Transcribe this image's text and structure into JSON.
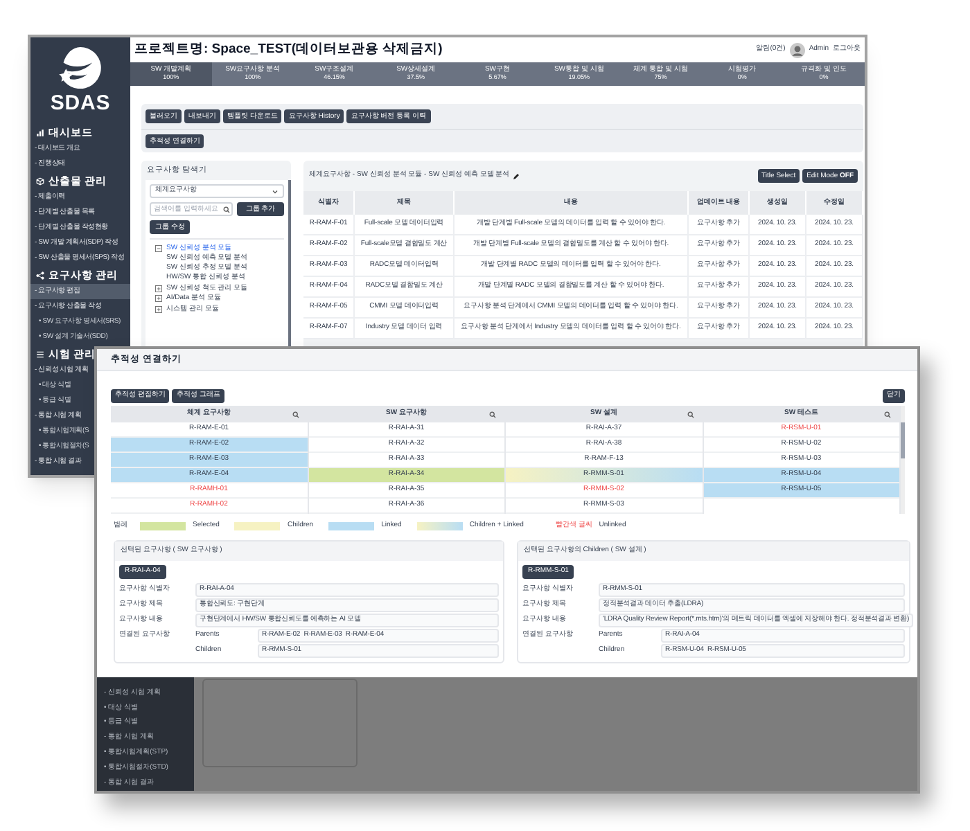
{
  "back_window": {
    "logo": "SDAS",
    "sidebar": [
      {
        "kind": "section",
        "label": "대시보드",
        "selected": false
      },
      {
        "kind": "item",
        "label": "- 대시보드 개요",
        "selected": false
      },
      {
        "kind": "item",
        "label": "- 진행상태",
        "selected": false
      },
      {
        "kind": "section",
        "label": "산출물 관리",
        "selected": false
      },
      {
        "kind": "item",
        "label": "- 제출이력",
        "selected": false
      },
      {
        "kind": "item",
        "label": "- 단계별 산출물 목록",
        "selected": false
      },
      {
        "kind": "item",
        "label": "- 단계별 산출물 작성현황",
        "selected": false
      },
      {
        "kind": "item",
        "label": "- SW 개발 계획서(SDP) 작성",
        "selected": false
      },
      {
        "kind": "item",
        "label": "- SW 산출물 명세서(SPS) 작성",
        "selected": false
      },
      {
        "kind": "section",
        "label": "요구사항 관리",
        "selected": false
      },
      {
        "kind": "item",
        "label": "- 요구사항 편집",
        "selected": true
      },
      {
        "kind": "item",
        "label": "- 요구사항 산출물 작성",
        "selected": false
      },
      {
        "kind": "subitem",
        "label": "• SW 요구사항 명세서(SRS)",
        "selected": false
      },
      {
        "kind": "subitem",
        "label": "• SW 설계 기술서(SDD)",
        "selected": false
      },
      {
        "kind": "section",
        "label": "시험 관리",
        "selected": false
      },
      {
        "kind": "item",
        "label": "- 신뢰성 시험 계획",
        "selected": false
      },
      {
        "kind": "subitem",
        "label": "• 대상 식별",
        "selected": false
      },
      {
        "kind": "subitem",
        "label": "• 등급 식별",
        "selected": false
      },
      {
        "kind": "item",
        "label": "- 통합 시험 계획",
        "selected": false
      },
      {
        "kind": "subitem",
        "label": "• 통합시험계획(S",
        "selected": false
      },
      {
        "kind": "subitem",
        "label": "• 통합시험절차(S",
        "selected": false
      },
      {
        "kind": "item",
        "label": "- 통합 시험 결과",
        "selected": false
      }
    ],
    "project_title": "프로젝트명: Space_TEST(데이터보관용 삭제금지)",
    "user": {
      "notice": "알림(0건)",
      "name": "Admin",
      "logout": "로그아웃"
    },
    "progress_steps": [
      {
        "label": "SW 개발계획",
        "value": "100%",
        "selected": true
      },
      {
        "label": "SW요구사항 분석",
        "value": "100%",
        "selected": false
      },
      {
        "label": "SW구조설계",
        "value": "46.15%",
        "selected": false
      },
      {
        "label": "SW상세설계",
        "value": "37.5%",
        "selected": false
      },
      {
        "label": "SW구현",
        "value": "5.67%",
        "selected": false
      },
      {
        "label": "SW통합 및 시험",
        "value": "19.05%",
        "selected": false
      },
      {
        "label": "체계 통합 및 시험",
        "value": "75%",
        "selected": false
      },
      {
        "label": "시험평가",
        "value": "0%",
        "selected": false
      },
      {
        "label": "규격화 및 인도",
        "value": "0%",
        "selected": false
      }
    ],
    "toolbar": [
      "불러오기",
      "내보내기",
      "템플릿 다운로드",
      "요구사항 History",
      "요구사항 버전 등록 이력"
    ],
    "trace_button": "추적성 연결하기",
    "explorer": {
      "title": "요구사항 탐색기",
      "dropdown": "체계요구사항",
      "search_placeholder": "검색어를 입력하세요",
      "add_group": "그룹 추가",
      "edit_group": "그룹 수정",
      "tree": [
        {
          "label": "SW 신뢰성 분석 모듈",
          "expanded": true,
          "selected": true,
          "children": [
            {
              "label": "SW 신뢰성 예측 모델 분석",
              "selected": false
            },
            {
              "label": "SW 신뢰성 추정 모델 분석",
              "selected": false
            },
            {
              "label": "HW/SW 통합 신뢰성 분석",
              "selected": false
            }
          ]
        },
        {
          "label": "SW 신뢰성 척도 관리 모듈",
          "expanded": false,
          "selected": false
        },
        {
          "label": "AI/Data 분석 모듈",
          "expanded": false,
          "selected": false
        },
        {
          "label": "시스템 관리 모듈",
          "expanded": false,
          "selected": false
        }
      ]
    },
    "requirements": {
      "breadcrumb": "체계요구사항 - SW 신뢰성 분석 모듈 - SW 신뢰성 예측 모델 분석",
      "title_select": "Title Select",
      "edit_mode": "Edit Mode **OFF**",
      "columns": [
        "식별자",
        "제목",
        "내용",
        "업데이트 내용",
        "생성일",
        "수정일"
      ],
      "rows": [
        [
          "R-RAM-F-01",
          "Full-scale 모델 데이터입력",
          "개발 단계별 Full-scale 모델의 데이터를 입력 할 수 있어야 한다.",
          "요구사항 추가",
          "2024. 10. 23.",
          "2024. 10. 23."
        ],
        [
          "R-RAM-F-02",
          "Full-scale모델 결함밀도 계산",
          "개발 단계별 Full-scale 모델의 결함밀도를 계산 할 수 있어야 한다.",
          "요구사항 추가",
          "2024. 10. 23.",
          "2024. 10. 23."
        ],
        [
          "R-RAM-F-03",
          "RADC모델 데이터입력",
          "개발 단계별 RADC 모델의 데이터를 입력 할 수 있어야 한다.",
          "요구사항 추가",
          "2024. 10. 23.",
          "2024. 10. 23."
        ],
        [
          "R-RAM-F-04",
          "RADC모델 결함밀도 계산",
          "개발 단계별 RADC 모델의 결함밀도를 계산 할 수 있어야 한다.",
          "요구사항 추가",
          "2024. 10. 23.",
          "2024. 10. 23."
        ],
        [
          "R-RAM-F-05",
          "CMMI 모델 데이터입력",
          "요구사항 분석 단계에서 CMMI 모델의 데이터를 입력 할 수 있어야 한다.",
          "요구사항 추가",
          "2024. 10. 23.",
          "2024. 10. 23."
        ],
        [
          "R-RAM-F-07",
          "Industry 모델 데이터 입력",
          "요구사항 분석 단계에서 Industry 모델의 데이터를 입력 할 수 있어야 한다.",
          "요구사항 추가",
          "2024. 10. 23.",
          "2024. 10. 23."
        ]
      ]
    }
  },
  "trace_window": {
    "sidebar": [
      "- 신뢰성 시험 계획",
      "• 대상 식별",
      "• 등급 식별",
      "- 통합 시험 계획",
      "• 통합시험계획(STP)",
      "• 통합시험절차(STD)",
      "- 통합 시험 결과"
    ],
    "dialog": {
      "title": "추적성 연결하기",
      "buttons": [
        "추적성 편집하기",
        "추적성 그래프"
      ],
      "close": "닫기",
      "columns": [
        {
          "header": "체계 요구사항",
          "cells": [
            {
              "text": "R-RAM-E-01",
              "selected": false,
              "child": false,
              "linked": false,
              "unlinked": false
            },
            {
              "text": "R-RAM-E-02",
              "selected": false,
              "child": false,
              "linked": true,
              "unlinked": false
            },
            {
              "text": "R-RAM-E-03",
              "selected": false,
              "child": false,
              "linked": true,
              "unlinked": false
            },
            {
              "text": "R-RAM-E-04",
              "selected": false,
              "child": false,
              "linked": true,
              "unlinked": false
            },
            {
              "text": "R-RAMH-01",
              "selected": false,
              "child": false,
              "linked": false,
              "unlinked": true
            },
            {
              "text": "R-RAMH-02",
              "selected": false,
              "child": false,
              "linked": false,
              "unlinked": true
            }
          ]
        },
        {
          "header": "SW 요구사항",
          "cells": [
            {
              "text": "R-RAI-A-31",
              "selected": false,
              "child": false,
              "linked": false,
              "unlinked": false
            },
            {
              "text": "R-RAI-A-32",
              "selected": false,
              "child": false,
              "linked": false,
              "unlinked": false
            },
            {
              "text": "R-RAI-A-33",
              "selected": false,
              "child": false,
              "linked": false,
              "unlinked": false
            },
            {
              "text": "R-RAI-A-34",
              "selected": true,
              "child": false,
              "linked": false,
              "unlinked": false
            },
            {
              "text": "R-RAI-A-35",
              "selected": false,
              "child": false,
              "linked": false,
              "unlinked": false
            },
            {
              "text": "R-RAI-A-36",
              "selected": false,
              "child": false,
              "linked": false,
              "unlinked": false
            }
          ]
        },
        {
          "header": "SW 설계",
          "cells": [
            {
              "text": "R-RAI-A-37",
              "selected": false,
              "child": false,
              "linked": false,
              "unlinked": false
            },
            {
              "text": "R-RAI-A-38",
              "selected": false,
              "child": false,
              "linked": false,
              "unlinked": false
            },
            {
              "text": "R-RAM-F-13",
              "selected": false,
              "child": false,
              "linked": false,
              "unlinked": false
            },
            {
              "text": "R-RMM-S-01",
              "selected": false,
              "child": true,
              "linked": true,
              "unlinked": false
            },
            {
              "text": "R-RMM-S-02",
              "selected": false,
              "child": false,
              "linked": false,
              "unlinked": true
            },
            {
              "text": "R-RMM-S-03",
              "selected": false,
              "child": false,
              "linked": false,
              "unlinked": false
            }
          ]
        },
        {
          "header": "SW 테스트",
          "cells": [
            {
              "text": "R-RSM-U-01",
              "selected": false,
              "child": false,
              "linked": false,
              "unlinked": true
            },
            {
              "text": "R-RSM-U-02",
              "selected": false,
              "child": false,
              "linked": false,
              "unlinked": false
            },
            {
              "text": "R-RSM-U-03",
              "selected": false,
              "child": false,
              "linked": false,
              "unlinked": false
            },
            {
              "text": "R-RSM-U-04",
              "selected": false,
              "child": false,
              "linked": true,
              "unlinked": false
            },
            {
              "text": "R-RSM-U-05",
              "selected": false,
              "child": false,
              "linked": true,
              "unlinked": false
            }
          ]
        }
      ],
      "legend": {
        "title": "범례",
        "items": [
          {
            "kind": "selected",
            "label": "Selected"
          },
          {
            "kind": "children",
            "label": "Children"
          },
          {
            "kind": "linked",
            "label": "Linked"
          },
          {
            "kind": "mixed",
            "label": "Children + Linked"
          }
        ],
        "unlinked_sample": "빨간색 글씨",
        "unlinked_label": "Unlinked"
      },
      "panels": [
        {
          "title": "선택된 요구사항 ( SW 요구사항 )",
          "chip": "R-RAI-A-04",
          "fields": [
            {
              "label": "요구사항 식별자",
              "value": "R-RAI-A-04"
            },
            {
              "label": "요구사항 제목",
              "value": "통합신뢰도: 구현단계"
            },
            {
              "label": "요구사항 내용",
              "value": "구현단계에서 HW/SW 통합신뢰도를 예측하는 AI 모델"
            }
          ],
          "linked_label": "연결된 요구사항",
          "parents_label": "Parents",
          "parents": "R-RAM-E-02  R-RAM-E-03  R-RAM-E-04",
          "children_label": "Children",
          "children": "R-RMM-S-01"
        },
        {
          "title": "선택된 요구사항의 Children ( SW 설계 )",
          "chip": "R-RMM-S-01",
          "fields": [
            {
              "label": "요구사항 식별자",
              "value": "R-RMM-S-01"
            },
            {
              "label": "요구사항 제목",
              "value": "정적분석결과 데이터 추출(LDRA)"
            },
            {
              "label": "요구사항 내용",
              "value": "'LDRA Quality Review Report(*.mts.htm)'의 메트릭 데이터를 엑셀에 저장해야 한다. 정적분석결과 변환)"
            }
          ],
          "linked_label": "연결된 요구사항",
          "parents_label": "Parents",
          "parents": "R-RAI-A-04",
          "children_label": "Children",
          "children": "R-RSM-U-04  R-RSM-U-05"
        }
      ]
    }
  }
}
